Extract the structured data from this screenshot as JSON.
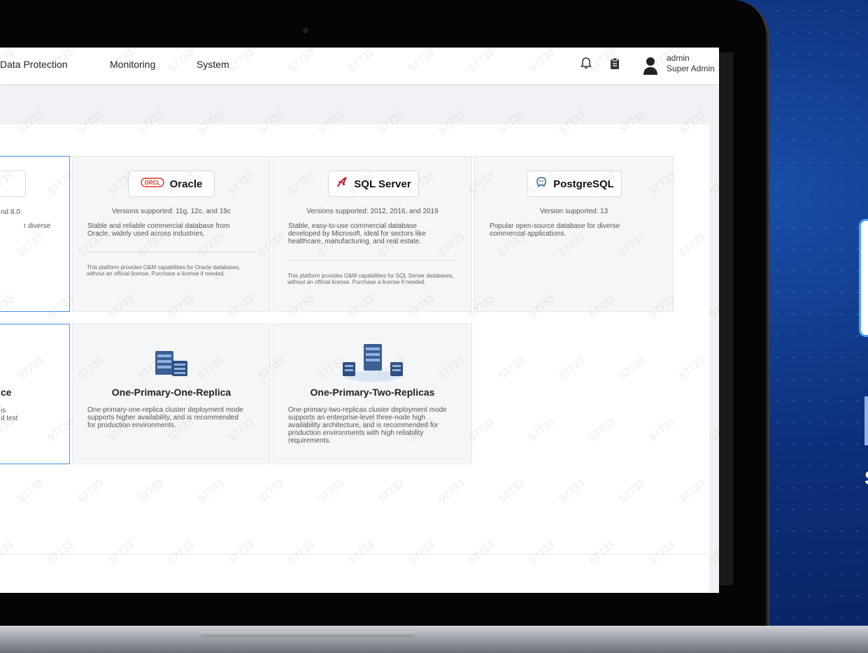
{
  "nav": {
    "items": [
      "Data Protection",
      "Monitoring",
      "System"
    ]
  },
  "user": {
    "name": "admin",
    "role": "Super Admin"
  },
  "icons": {
    "bell": "bell-icon",
    "clipboard": "clipboard-icon",
    "avatar": "user-avatar-icon",
    "oracle": "oracle-logo-icon",
    "sqlserver": "sqlserver-logo-icon",
    "postgresql": "postgresql-logo-icon"
  },
  "colors": {
    "accent": "#4a90e2",
    "oracle": "#e0312b",
    "sqlserver": "#c8102e"
  },
  "databases": {
    "partial": {
      "ver_tail": "nd 8.0.",
      "desc_tail": "r diverse"
    },
    "oracle": {
      "name": "Oracle",
      "logo_text": "ORCL",
      "versions": "Versions supported: 11g, 12c, and 19c",
      "desc": "Stable and reliable commercial database from Oracle, widely used across industries.",
      "note": "This platform provides O&M capabilities for Oracle databases, without an official license. Purchase a license if needed."
    },
    "sqlserver": {
      "name": "SQL Server",
      "versions": "Versions supported: 2012, 2016, and 2019",
      "desc": "Stable, easy-to-use commercial database developed by Microsoft, ideal for sectors like healthcare, manufacturing, and real estate.",
      "note": "This platform provides O&M capabilities for SQL Server databases, without an official license. Purchase a license if needed."
    },
    "postgresql": {
      "name": "PostgreSQL",
      "versions": "Version supported: 13",
      "desc": "Popular open-source database for diverse commercial applications."
    }
  },
  "deployments": {
    "partial": {
      "title_tail": "ce",
      "line1": "is",
      "line2": "d test"
    },
    "one_replica": {
      "title": "One-Primary-One-Replica",
      "desc": "One-primary-one-replica cluster deployment mode supports higher availability, and is recommended for production environments."
    },
    "two_replicas": {
      "title": "One-Primary-Two-Replicas",
      "desc": "One-primary-two-replicas cluster deployment mode supports an enterprise-level three-node high availability architecture, and is recommended for production environments with high reliability requirements."
    }
  },
  "watermark": "57733"
}
